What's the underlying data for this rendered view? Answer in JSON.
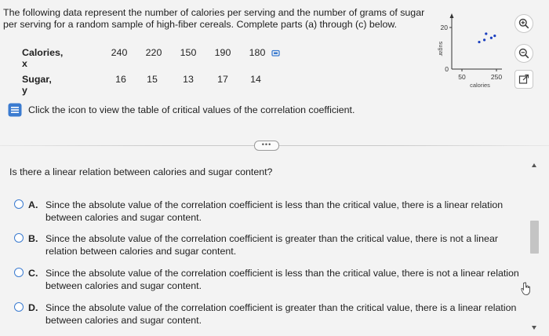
{
  "problem": {
    "intro": "The following data represent the number of calories per serving and the number of grams of sugar per serving for a random sample of high-fiber cereals. Complete parts (a) through (c) below.",
    "calories_label": "Calories, x",
    "sugar_label": "Sugar, y",
    "calories": [
      "240",
      "220",
      "150",
      "190",
      "180"
    ],
    "sugar": [
      "16",
      "15",
      "13",
      "17",
      "14"
    ],
    "hint": "Click the icon to view the table of critical values of the correlation coefficient."
  },
  "plot": {
    "y_axis_label": "sugar",
    "x_axis_label": "calories",
    "y_ticks": [
      "20",
      "0"
    ],
    "x_ticks": [
      "50",
      "250"
    ],
    "chart_data": {
      "type": "scatter",
      "x": [
        240,
        220,
        150,
        190,
        180
      ],
      "y": [
        16,
        15,
        13,
        17,
        14
      ],
      "xlabel": "calories",
      "ylabel": "sugar",
      "xlim": [
        0,
        300
      ],
      "ylim": [
        0,
        25
      ]
    }
  },
  "more_button": "•••",
  "question": "Is there a linear relation between calories and sugar content?",
  "options": [
    {
      "letter": "A.",
      "text": "Since the absolute value of the correlation coefficient is less than the critical value, there is a linear relation between calories and sugar content."
    },
    {
      "letter": "B.",
      "text": "Since the absolute value of the correlation coefficient is greater than the critical value, there is not a linear relation between calories and sugar content."
    },
    {
      "letter": "C.",
      "text": "Since the absolute value of the correlation coefficient is less than the critical value, there is not a linear relation between calories and sugar content."
    },
    {
      "letter": "D.",
      "text": "Since the absolute value of the correlation coefficient is greater than the critical value, there is a linear relation between calories and sugar content."
    }
  ],
  "colors": {
    "accent": "#3b7bd0",
    "radio_border": "#3b7bd0",
    "background": "#f3f3f3"
  },
  "icons": {
    "copy": "copy-icon",
    "hint": "table-icon",
    "zoom_in": "zoom-in-icon",
    "zoom_out": "zoom-out-icon",
    "expand": "expand-icon"
  }
}
